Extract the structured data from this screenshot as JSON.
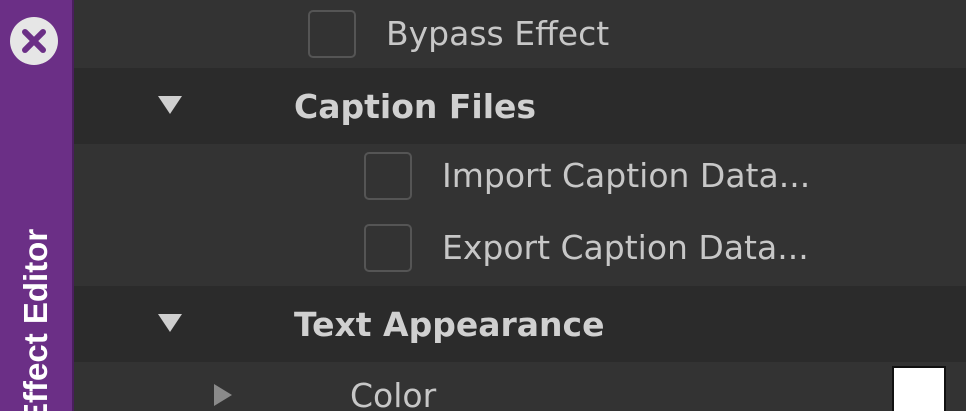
{
  "sidebar": {
    "title": "Effect Editor",
    "close_icon": "close-icon"
  },
  "rows": {
    "bypass": {
      "label": "Bypass Effect",
      "checked": false
    },
    "caption_files": {
      "label": "Caption Files",
      "expanded": true
    },
    "import": {
      "label": "Import Caption Data...",
      "checked": false
    },
    "export": {
      "label": "Export Caption Data...",
      "checked": false
    },
    "text_appearance": {
      "label": "Text Appearance",
      "expanded": true
    },
    "color": {
      "label": "Color",
      "expanded": false,
      "swatch": "#ffffff"
    }
  },
  "colors": {
    "tab_purple": "#6b2f86",
    "panel_bg": "#333333",
    "header_bg": "#2b2b2b"
  }
}
